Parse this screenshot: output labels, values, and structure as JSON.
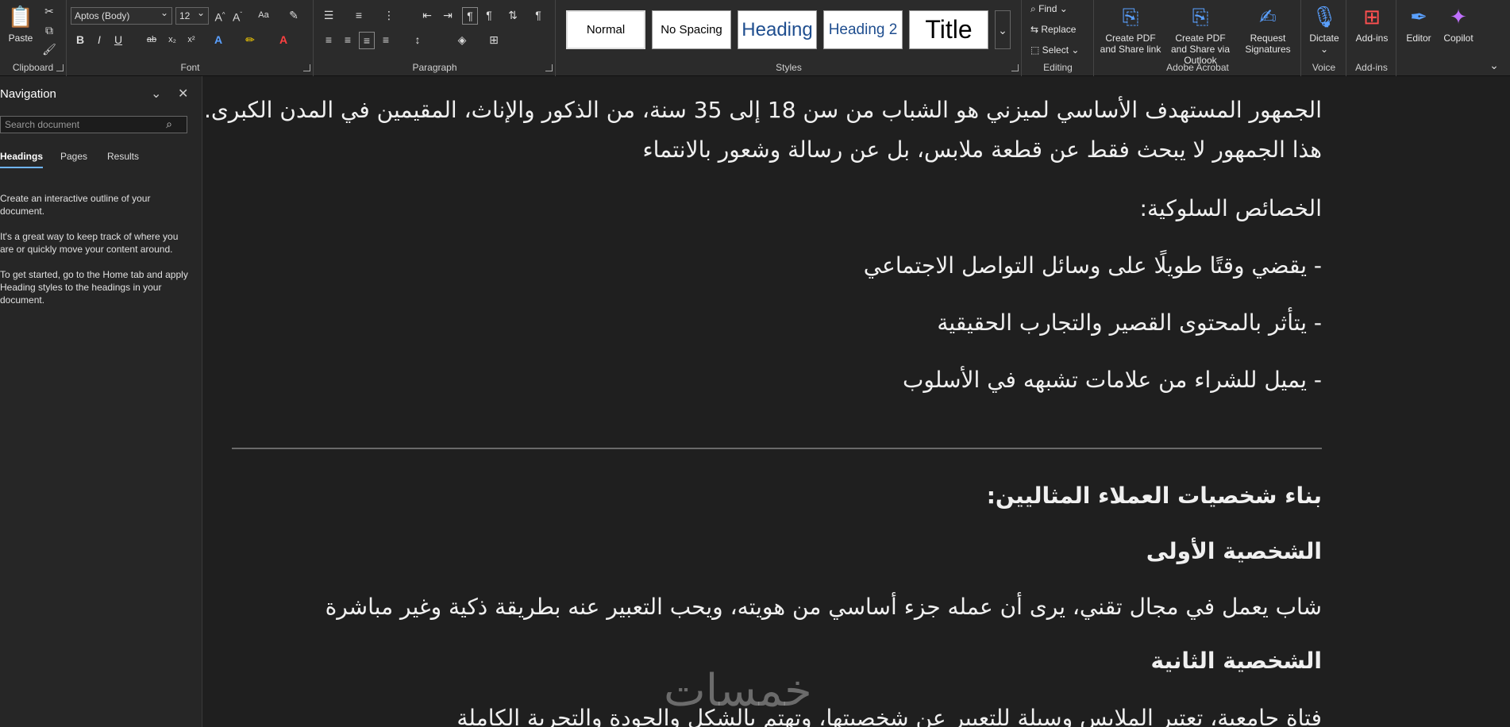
{
  "ribbon": {
    "clipboard": {
      "paste": "Paste",
      "label": "Clipboard"
    },
    "font": {
      "name": "Aptos (Body)",
      "size": "12",
      "label": "Font",
      "bold": "B",
      "italic": "I",
      "underline": "U",
      "strike": "ab",
      "sub": "x₂",
      "sup": "x²",
      "font_color_glyph": "A",
      "case": "Aa"
    },
    "paragraph": {
      "label": "Paragraph"
    },
    "styles": {
      "label": "Styles",
      "items": [
        "Normal",
        "No Spacing",
        "Heading",
        "Heading 2",
        "Title"
      ]
    },
    "editing": {
      "label": "Editing",
      "find": "Find",
      "replace": "Replace",
      "select": "Select"
    },
    "acrobat": {
      "label": "Adobe Acrobat",
      "create_pdf_share": "Create PDF and Share link",
      "create_pdf_outlook": "Create PDF and Share via Outlook",
      "request_signatures": "Request Signatures"
    },
    "voice": {
      "label": "Voice",
      "dictate": "Dictate"
    },
    "addins": {
      "label": "Add-ins",
      "addins": "Add-ins"
    },
    "editor": "Editor",
    "copilot": "Copilot"
  },
  "nav": {
    "title": "Navigation",
    "search_placeholder": "Search document",
    "tabs": [
      "Headings",
      "Pages",
      "Results"
    ],
    "hints": [
      "Create an interactive outline of your document.",
      "It's a great way to keep track of where you are or quickly move your content around.",
      "To get started, go to the Home tab and apply Heading styles to the headings in your document."
    ]
  },
  "document": {
    "p1": "الجمهور المستهدف الأساسي لميزني هو الشباب من سن 18 إلى 35 سنة، من الذكور والإناث، المقيمين في المدن الكبرى.",
    "p2": "هذا الجمهور لا يبحث فقط عن قطعة ملابس، بل عن رسالة وشعور بالانتماء",
    "p3": "الخصائص السلوكية:",
    "b1": "- يقضي وقتًا طويلًا على وسائل التواصل الاجتماعي",
    "b2": "- يتأثر بالمحتوى القصير والتجارب الحقيقية",
    "b3": "- يميل للشراء من علامات تشبهه في الأسلوب",
    "h1": "بناء شخصيات العملاء المثاليين:",
    "h2": "الشخصية الأولى",
    "p4": "شاب يعمل في مجال تقني، يرى أن عمله جزء أساسي من هويته، ويحب التعبير عنه بطريقة ذكية وغير مباشرة",
    "h3": "الشخصية الثانية",
    "p5": "فتاة جامعية، تعتبر الملابس وسيلة للتعبير عن شخصيتها، وتهتم بالشكل والجودة والتجربة الكاملة"
  },
  "watermark": "خمسات"
}
